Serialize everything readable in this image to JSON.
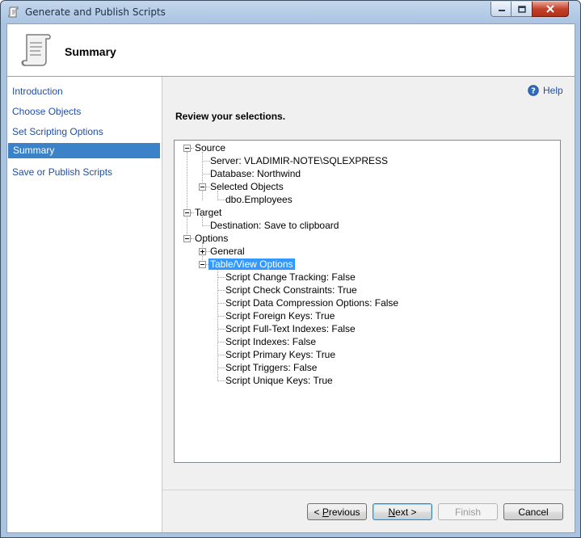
{
  "window": {
    "title": "Generate and Publish Scripts"
  },
  "header": {
    "title": "Summary"
  },
  "nav": {
    "items": [
      {
        "label": "Introduction",
        "active": false
      },
      {
        "label": "Choose Objects",
        "active": false
      },
      {
        "label": "Set Scripting Options",
        "active": false
      },
      {
        "label": "Summary",
        "active": true
      },
      {
        "label": "Save or Publish Scripts",
        "active": false
      }
    ]
  },
  "help": {
    "label": "Help"
  },
  "main": {
    "review_label": "Review your selections."
  },
  "tree": {
    "source": "Source",
    "server": "Server: VLADIMIR-NOTE\\SQLEXPRESS",
    "database": "Database: Northwind",
    "selected_objects": "Selected Objects",
    "employees": "dbo.Employees",
    "target": "Target",
    "destination": "Destination: Save to clipboard",
    "options": "Options",
    "general": "General",
    "table_view_options": "Table/View Options",
    "table_view_items": [
      "Script Change Tracking: False",
      "Script Check Constraints: True",
      "Script Data Compression Options: False",
      "Script Foreign Keys: True",
      "Script Full-Text Indexes: False",
      "Script Indexes: False",
      "Script Primary Keys: True",
      "Script Triggers: False",
      "Script Unique Keys: True"
    ]
  },
  "buttons": {
    "previous_mnemonic": "P",
    "previous_rest": "revious",
    "previous_prefix": "< ",
    "next_mnemonic": "N",
    "next_rest": "ext >",
    "finish_label": "Finish",
    "cancel_label": "Cancel"
  },
  "icons": {
    "title": "scroll-icon",
    "header": "scroll-icon",
    "help": "help-icon",
    "minimize": "minimize-icon",
    "maximize": "maximize-icon",
    "close": "close-icon"
  },
  "colors": {
    "accent": "#3c82c8",
    "selection": "#3399ff",
    "link": "#1f4fa8",
    "close": "#c5412c"
  }
}
